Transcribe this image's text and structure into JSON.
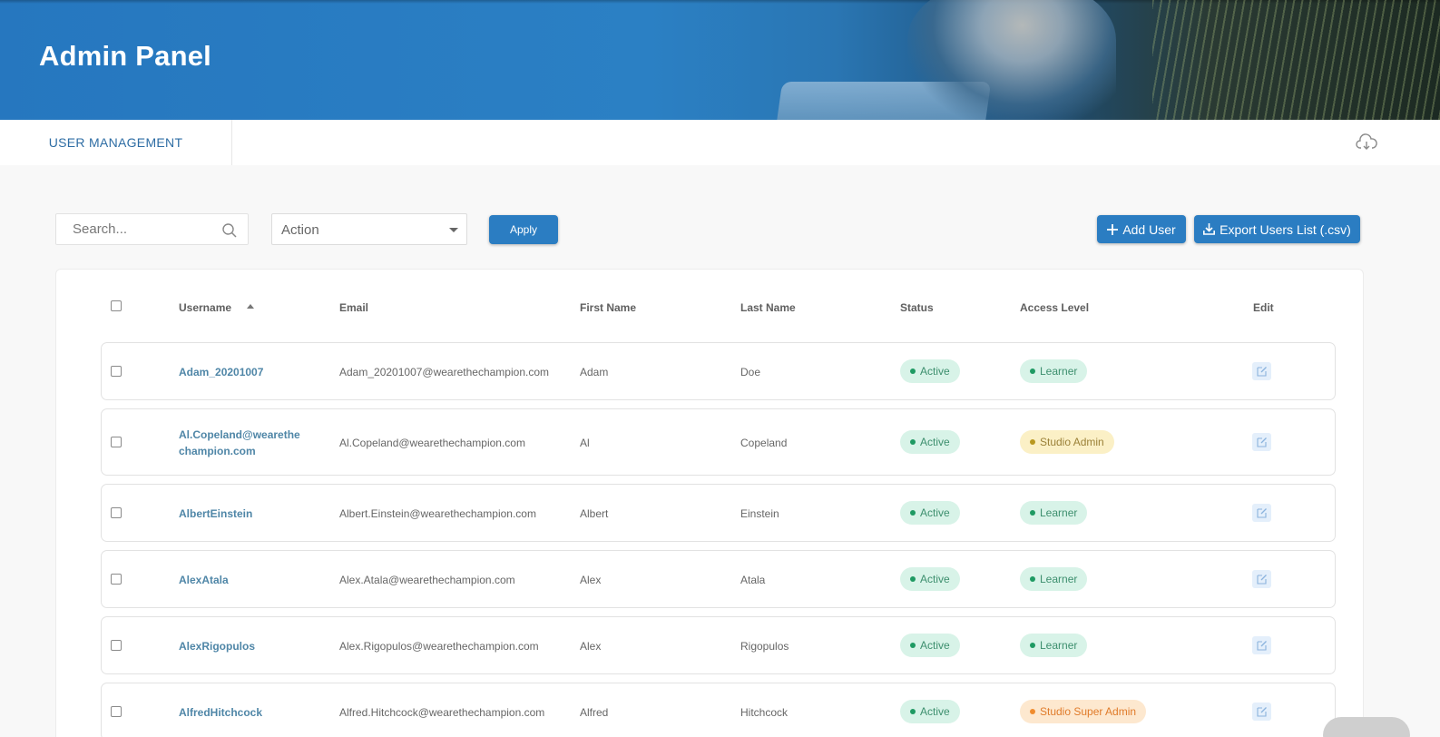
{
  "header": {
    "title": "Admin Panel"
  },
  "tabs": [
    {
      "label": "USER MANAGEMENT"
    }
  ],
  "toolbar": {
    "search_placeholder": "Search...",
    "action_value": "Action",
    "apply_label": "Apply",
    "add_user_label": "Add User",
    "export_label": "Export Users List (.csv)"
  },
  "table": {
    "columns": {
      "username": "Username",
      "email": "Email",
      "first_name": "First Name",
      "last_name": "Last Name",
      "status": "Status",
      "access_level": "Access Level",
      "edit": "Edit"
    },
    "sort": {
      "column": "Username",
      "direction": "ascending"
    },
    "rows": [
      {
        "username": "Adam_20201007",
        "email": "Adam_20201007@wearethechampion.com",
        "first_name": "Adam",
        "last_name": "Doe",
        "status": "Active",
        "access_level": "Learner"
      },
      {
        "username": "Al.Copeland@wearethechampion.com",
        "email": "Al.Copeland@wearethechampion.com",
        "first_name": "Al",
        "last_name": "Copeland",
        "status": "Active",
        "access_level": "Studio Admin"
      },
      {
        "username": "AlbertEinstein",
        "email": "Albert.Einstein@wearethechampion.com",
        "first_name": "Albert",
        "last_name": "Einstein",
        "status": "Active",
        "access_level": "Learner"
      },
      {
        "username": "AlexAtala",
        "email": "Alex.Atala@wearethechampion.com",
        "first_name": "Alex",
        "last_name": "Atala",
        "status": "Active",
        "access_level": "Learner"
      },
      {
        "username": "AlexRigopulos",
        "email": "Alex.Rigopulos@wearethechampion.com",
        "first_name": "Alex",
        "last_name": "Rigopulos",
        "status": "Active",
        "access_level": "Learner"
      },
      {
        "username": "AlfredHitchcock",
        "email": "Alfred.Hitchcock@wearethechampion.com",
        "first_name": "Alfred",
        "last_name": "Hitchcock",
        "status": "Active",
        "access_level": "Studio Super Admin"
      }
    ]
  },
  "colors": {
    "primary": "#2b7dc2",
    "tab_text": "#2e6da4",
    "status_active": "#1f9a63",
    "learner": "#1f9a63",
    "studio_admin": "#b99820",
    "studio_super_admin": "#f08c2e"
  },
  "icons": {
    "search": "search-icon",
    "cloud_download": "cloud-download-icon",
    "add": "plus-icon",
    "export": "download-icon",
    "edit": "edit-icon",
    "sort": "sort-up-icon",
    "dropdown": "caret-down-icon"
  }
}
